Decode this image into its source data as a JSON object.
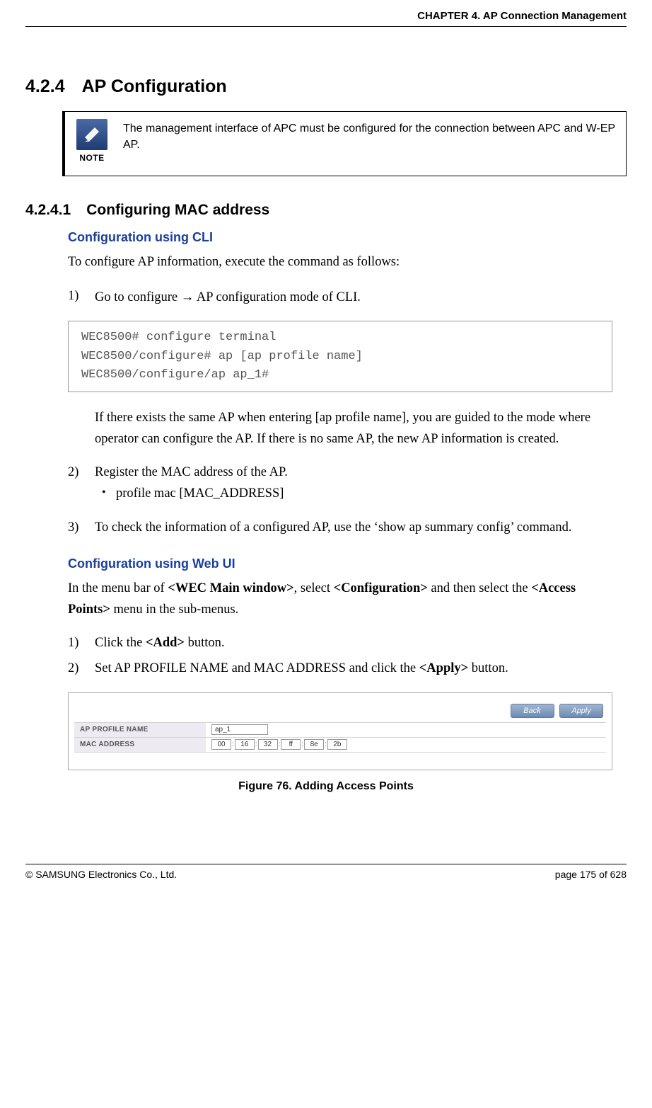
{
  "chapterHeader": "CHAPTER 4. AP Connection Management",
  "section": {
    "number": "4.2.4",
    "title": "AP Configuration"
  },
  "note": {
    "label": "NOTE",
    "text": "The management interface of APC must be configured for the connection between APC and W-EP AP."
  },
  "subsection": {
    "number": "4.2.4.1",
    "title": "Configuring MAC address"
  },
  "cli": {
    "heading": "Configuration using CLI",
    "intro": "To configure AP information, execute the command as follows:",
    "step1_num": "1)",
    "step1_pre": "Go to configure ",
    "step1_arrow": "→",
    "step1_post": " AP configuration mode of CLI.",
    "code": "WEC8500# configure terminal\nWEC8500/configure# ap [ap profile name]\nWEC8500/configure/ap ap_1#",
    "after_code_para": "If there exists the same AP when entering [ap profile name], you are guided to the mode where operator can configure the AP. If there is no same AP, the new AP information is created.",
    "step2_num": "2)",
    "step2_text": "Register the MAC address of the AP.",
    "step2_bullet": "profile mac [MAC_ADDRESS]",
    "step3_num": "3)",
    "step3_text": "To check the information of a configured AP, use the ‘show ap summary config’ command."
  },
  "webui": {
    "heading": "Configuration using Web UI",
    "intro_pre": "In the menu bar of ",
    "wec": "<WEC Main window>",
    "intro_mid": ", select ",
    "conf": "<Configuration>",
    "intro_post1": " and then select the ",
    "ap": "<Access Points>",
    "intro_post2": " menu in the sub-menus.",
    "step1_num": "1)",
    "step1_pre": "Click the ",
    "add": "<Add>",
    "step1_post": " button.",
    "step2_num": "2)",
    "step2_pre": "Set AP PROFILE NAME and MAC ADDRESS and click the ",
    "apply": "<Apply>",
    "step2_post": " button."
  },
  "figure": {
    "back_btn": "Back",
    "apply_btn": "Apply",
    "row1_label": "AP PROFILE NAME",
    "row1_value": "ap_1",
    "row2_label": "MAC ADDRESS",
    "mac": [
      "00",
      "16",
      "32",
      "ff",
      "8e",
      "2b"
    ],
    "caption": "Figure 76. Adding Access Points"
  },
  "footer": {
    "left": "© SAMSUNG Electronics Co., Ltd.",
    "right": "page 175 of 628"
  }
}
